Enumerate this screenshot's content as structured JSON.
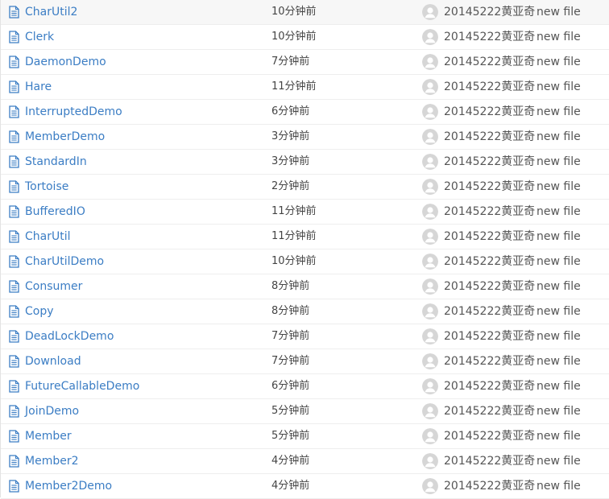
{
  "icons": {
    "file": "file-icon",
    "avatar": "user-avatar-icon"
  },
  "colors": {
    "link": "#3b7dc4",
    "text": "#444444",
    "icon": "#3b7dc4",
    "avatar_bg": "#d6d6d6"
  },
  "files": [
    {
      "name": "CharUtil2",
      "time": "10分钟前",
      "author": "20145222黄亚奇",
      "message": "new file"
    },
    {
      "name": "Clerk",
      "time": "10分钟前",
      "author": "20145222黄亚奇",
      "message": "new file"
    },
    {
      "name": "DaemonDemo",
      "time": "7分钟前",
      "author": "20145222黄亚奇",
      "message": "new file"
    },
    {
      "name": "Hare",
      "time": "11分钟前",
      "author": "20145222黄亚奇",
      "message": "new file"
    },
    {
      "name": "InterruptedDemo",
      "time": "6分钟前",
      "author": "20145222黄亚奇",
      "message": "new file"
    },
    {
      "name": "MemberDemo",
      "time": "3分钟前",
      "author": "20145222黄亚奇",
      "message": "new file"
    },
    {
      "name": "StandardIn",
      "time": "3分钟前",
      "author": "20145222黄亚奇",
      "message": "new file"
    },
    {
      "name": "Tortoise",
      "time": "2分钟前",
      "author": "20145222黄亚奇",
      "message": "new file"
    },
    {
      "name": "BufferedIO",
      "time": "11分钟前",
      "author": "20145222黄亚奇",
      "message": "new file"
    },
    {
      "name": "CharUtil",
      "time": "11分钟前",
      "author": "20145222黄亚奇",
      "message": "new file"
    },
    {
      "name": "CharUtilDemo",
      "time": "10分钟前",
      "author": "20145222黄亚奇",
      "message": "new file"
    },
    {
      "name": "Consumer",
      "time": "8分钟前",
      "author": "20145222黄亚奇",
      "message": "new file"
    },
    {
      "name": "Copy",
      "time": "8分钟前",
      "author": "20145222黄亚奇",
      "message": "new file"
    },
    {
      "name": "DeadLockDemo",
      "time": "7分钟前",
      "author": "20145222黄亚奇",
      "message": "new file"
    },
    {
      "name": "Download",
      "time": "7分钟前",
      "author": "20145222黄亚奇",
      "message": "new file"
    },
    {
      "name": "FutureCallableDemo",
      "time": "6分钟前",
      "author": "20145222黄亚奇",
      "message": "new file"
    },
    {
      "name": "JoinDemo",
      "time": "5分钟前",
      "author": "20145222黄亚奇",
      "message": "new file"
    },
    {
      "name": "Member",
      "time": "5分钟前",
      "author": "20145222黄亚奇",
      "message": "new file"
    },
    {
      "name": "Member2",
      "time": "4分钟前",
      "author": "20145222黄亚奇",
      "message": "new file"
    },
    {
      "name": "Member2Demo",
      "time": "4分钟前",
      "author": "20145222黄亚奇",
      "message": "new file"
    }
  ]
}
